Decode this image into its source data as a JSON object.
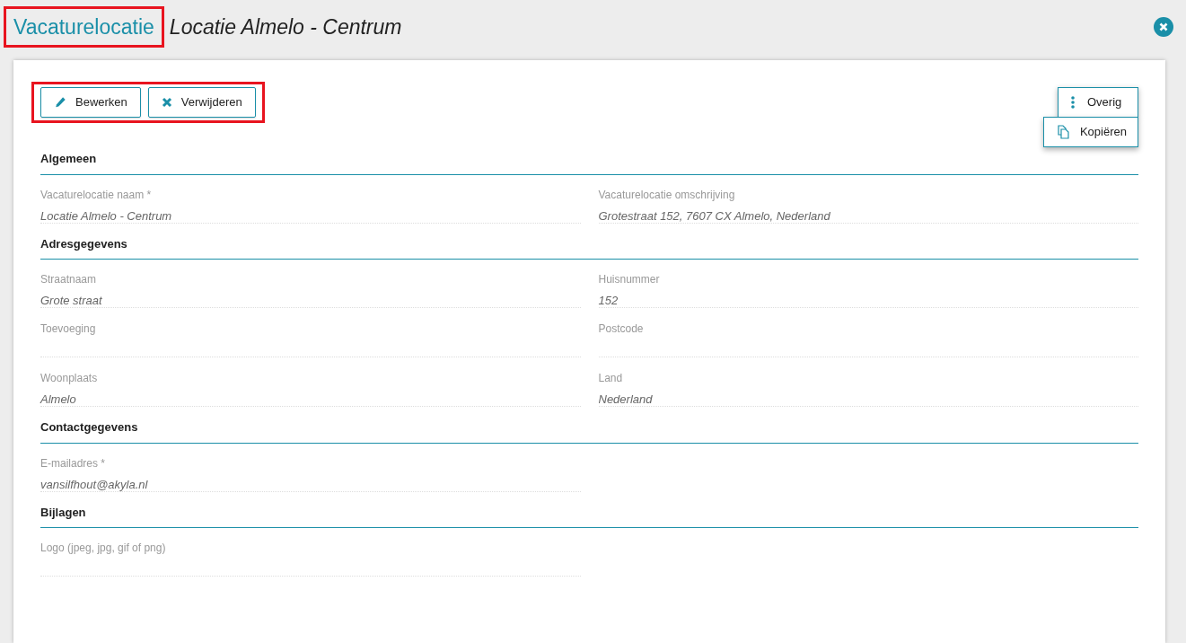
{
  "header": {
    "title_link": "Vacaturelocatie",
    "title": "Locatie Almelo - Centrum"
  },
  "actions": [
    {
      "label": "Bewerken",
      "kind": "edit"
    },
    {
      "label": "Verwijderen",
      "kind": "delete"
    }
  ],
  "more_menu": {
    "label": "Overig",
    "expanded": true,
    "items": [
      {
        "label": "Kopiëren",
        "kind": "copy"
      }
    ]
  },
  "sections": [
    {
      "title": "Algemeen",
      "fields": [
        {
          "label": "Vacaturelocatie naam *",
          "value": "Locatie Almelo - Centrum"
        },
        {
          "label": "Vacaturelocatie omschrijving",
          "value": "Grotestraat 152, 7607 CX Almelo, Nederland"
        }
      ]
    },
    {
      "title": "Adresgegevens",
      "fields": [
        {
          "label": "Straatnaam",
          "value": "Grote straat"
        },
        {
          "label": "Huisnummer",
          "value": "152"
        },
        {
          "label": "Toevoeging"
        },
        {
          "label": "Postcode"
        },
        {
          "label": "Woonplaats",
          "value": "Almelo"
        },
        {
          "label": "Land",
          "value": "Nederland"
        }
      ]
    },
    {
      "title": "Contactgegevens",
      "fields": [
        {
          "label": "E-mailadres *",
          "value": "vansilfhout@akyla.nl"
        }
      ]
    },
    {
      "title": "Bijlagen",
      "fields": [
        {
          "label": "Logo (jpeg, jpg, gif of png)"
        }
      ]
    }
  ]
}
